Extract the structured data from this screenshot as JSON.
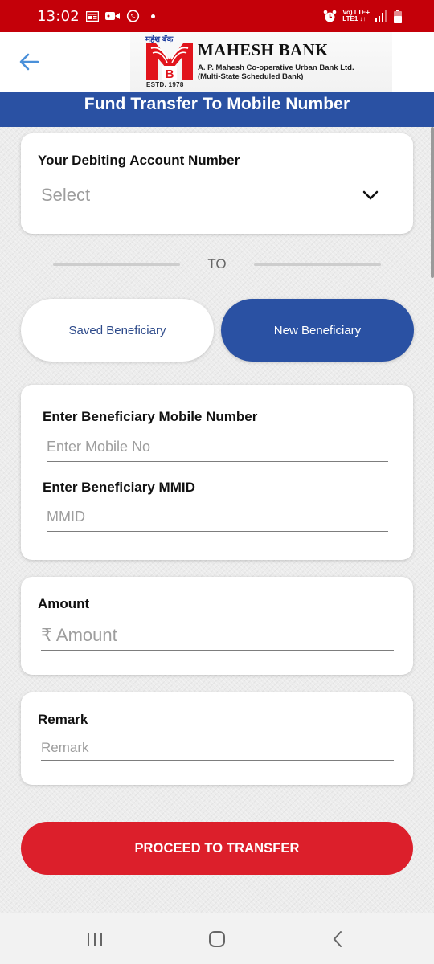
{
  "status_bar": {
    "time": "13:02",
    "left_icons": [
      "news-icon",
      "video-camera-icon",
      "whatsapp-icon",
      "notification-dot-icon"
    ],
    "right_icons": [
      "alarm-icon",
      "network-lte-icon",
      "signal-icon",
      "battery-icon"
    ],
    "network_line1": "Vo) LTE+",
    "network_line2": "LTE1 ↓↑"
  },
  "header": {
    "back_icon": "arrow-left-icon",
    "logo": {
      "hindi_name": "महेश बँक",
      "bank_name": "MAHESH BANK",
      "subtitle_line1": "A. P. Mahesh Co-operative Urban Bank Ltd.",
      "subtitle_line2": "(Multi-State Scheduled Bank)",
      "established": "ESTD. 1978"
    },
    "accent_color": "#2a51a3"
  },
  "page_title": "Fund Transfer To Mobile Number",
  "debit_account": {
    "label": "Your Debiting Account Number",
    "selected": "Select"
  },
  "divider_text": "TO",
  "beneficiary_tabs": [
    {
      "label": "Saved Beneficiary",
      "active": false
    },
    {
      "label": "New Beneficiary",
      "active": true
    }
  ],
  "beneficiary_form": {
    "mobile_label": "Enter Beneficiary Mobile Number",
    "mobile_placeholder": "Enter Mobile No",
    "mobile_value": "",
    "mmid_label": "Enter Beneficiary MMID",
    "mmid_placeholder": "MMID",
    "mmid_value": ""
  },
  "amount": {
    "label": "Amount",
    "placeholder": "₹ Amount",
    "value": ""
  },
  "remark": {
    "label": "Remark",
    "placeholder": "Remark",
    "value": ""
  },
  "proceed_button": "PROCEED TO TRANSFER",
  "colors": {
    "status_bar": "#c40009",
    "primary_blue": "#2a51a3",
    "proceed_red": "#dc1f2b",
    "back_arrow": "#4a90d9"
  },
  "nav_bar": {
    "recents": "recent-apps-icon",
    "home": "home-icon",
    "back": "back-icon"
  }
}
